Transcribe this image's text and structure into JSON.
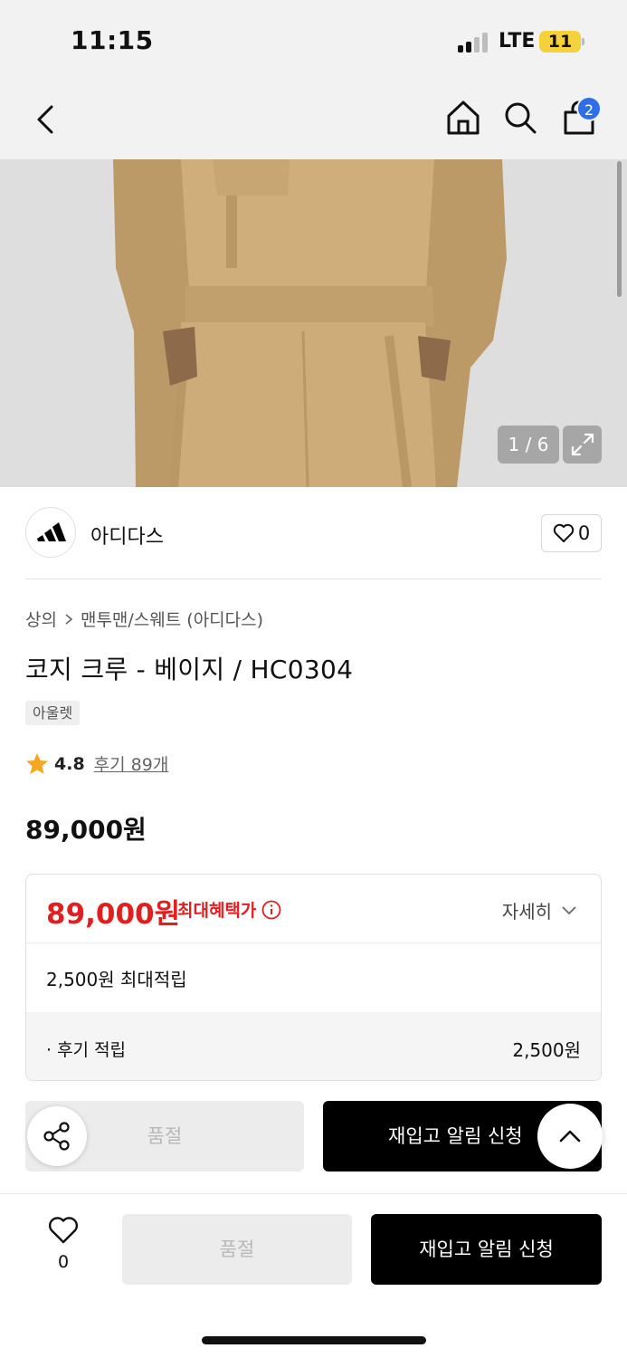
{
  "status_bar": {
    "time": "11:15",
    "network": "LTE",
    "battery": "11"
  },
  "nav": {
    "cart_count": "2",
    "icons": [
      "back-arrow-icon",
      "home-icon",
      "search-icon",
      "cart-icon"
    ]
  },
  "gallery": {
    "counter": "1 / 6",
    "icons": [
      "expand-icon"
    ]
  },
  "brand": {
    "name": "아디다스",
    "likes": "0"
  },
  "breadcrumb": {
    "category": "상의",
    "subcategory": "맨투맨/스웨트 (아디다스)"
  },
  "product": {
    "title": "코지 크루 - 베이지 / HC0304",
    "tag": "아울렛",
    "rating": "4.8",
    "reviews": "후기 89개",
    "price": "89,000원"
  },
  "benefit": {
    "price": "89,000원",
    "label": "최대혜택가",
    "details": "자세히",
    "points": "2,500원 최대적립",
    "review_label": "· 후기 적립",
    "review_value": "2,500원"
  },
  "actions": {
    "soldout": "품절",
    "restock": "재입고 알림 신청"
  },
  "bottom_bar": {
    "likes": "0",
    "soldout": "품절",
    "restock": "재입고 알림 신청"
  },
  "colors": {
    "accent_red": "#e02020",
    "badge_blue": "#2f6fe6",
    "star": "#f5a623",
    "product_beige": "#c8a877"
  }
}
